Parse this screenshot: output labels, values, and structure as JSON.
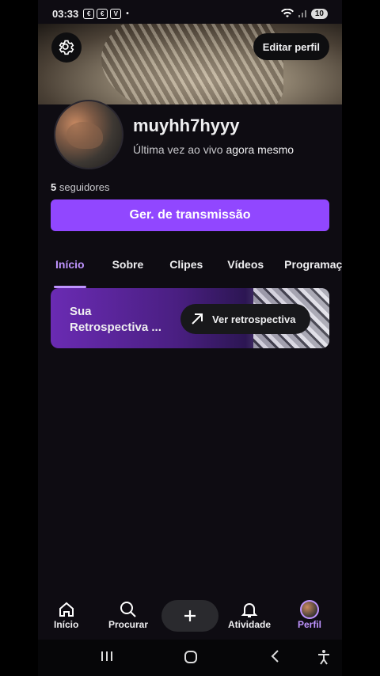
{
  "status_bar": {
    "time": "03:33",
    "notif_icons": [
      "€",
      "€",
      "V"
    ],
    "dot": "•",
    "battery": "10"
  },
  "header": {
    "edit_profile": "Editar perfil"
  },
  "profile": {
    "username": "muyhh7hyyy",
    "last_live_prefix": "Última vez ao vivo",
    "last_live_value": "agora mesmo",
    "followers_count": "5",
    "followers_label": "seguidores"
  },
  "stream_manager_button": "Ger. de transmissão",
  "tabs": [
    {
      "label": "Início",
      "active": true
    },
    {
      "label": "Sobre",
      "active": false
    },
    {
      "label": "Clipes",
      "active": false
    },
    {
      "label": "Vídeos",
      "active": false
    },
    {
      "label": "Programaçã",
      "active": false
    }
  ],
  "recap": {
    "title": "Sua Retrospectiva ...",
    "button": "Ver retrospectiva"
  },
  "bottom_nav": [
    {
      "label": "Início",
      "icon": "home-icon"
    },
    {
      "label": "Procurar",
      "icon": "search-icon"
    },
    {
      "label": "",
      "icon": "plus-icon"
    },
    {
      "label": "Atividade",
      "icon": "bell-icon"
    },
    {
      "label": "Perfil",
      "icon": "avatar",
      "active": true
    }
  ],
  "colors": {
    "accent": "#9147ff",
    "accent_light": "#bf94ff",
    "background": "#0e0c12"
  }
}
